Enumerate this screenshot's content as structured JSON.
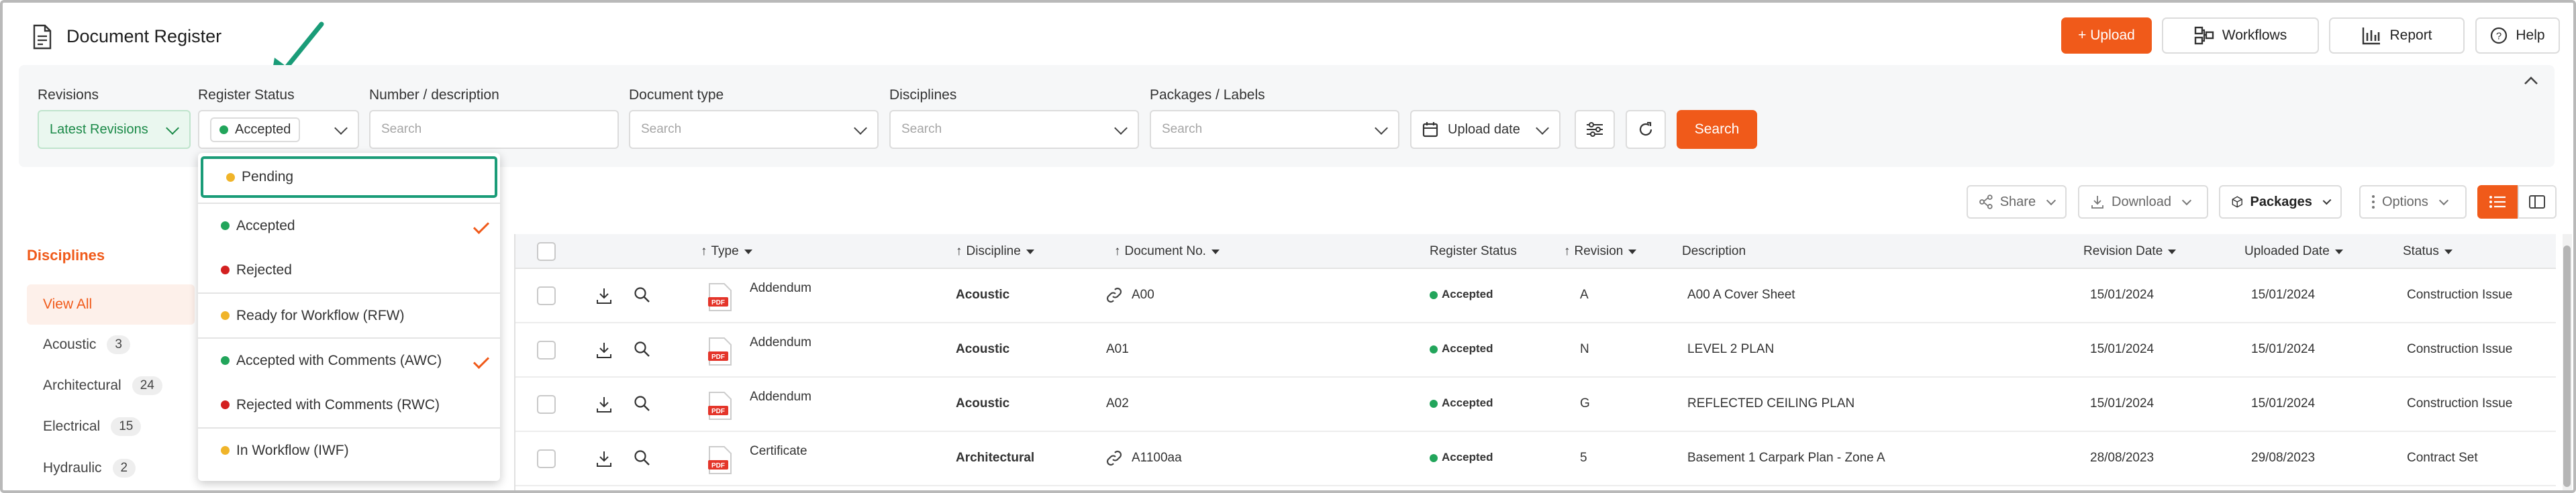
{
  "header": {
    "title": "Document Register",
    "buttons": {
      "upload": "+ Upload",
      "workflows": "Workflows",
      "report": "Report",
      "help": "Help"
    }
  },
  "filters": {
    "revisions": {
      "label": "Revisions",
      "value": "Latest Revisions"
    },
    "register_status": {
      "label": "Register Status",
      "value": "Accepted"
    },
    "number_description": {
      "label": "Number / description",
      "placeholder": "Search"
    },
    "document_type": {
      "label": "Document type",
      "placeholder": "Search"
    },
    "disciplines": {
      "label": "Disciplines",
      "placeholder": "Search"
    },
    "packages_labels": {
      "label": "Packages / Labels",
      "placeholder": "Search"
    },
    "upload_date": "Upload date",
    "search_button": "Search"
  },
  "status_dropdown": {
    "items": [
      {
        "label": "Pending",
        "color": "#f0b429",
        "checked": false,
        "highlighted": true
      },
      {
        "label": "Accepted",
        "color": "#22a55b",
        "checked": true
      },
      {
        "label": "Rejected",
        "color": "#d32020",
        "checked": false
      },
      {
        "label": "Ready for Workflow (RFW)",
        "color": "#f0b429",
        "checked": false
      },
      {
        "label": "Accepted with Comments (AWC)",
        "color": "#22a55b",
        "checked": true
      },
      {
        "label": "Rejected with Comments (RWC)",
        "color": "#d32020",
        "checked": false
      },
      {
        "label": "In Workflow (IWF)",
        "color": "#f0b429",
        "checked": false
      }
    ]
  },
  "toolbar": {
    "share": "Share",
    "download": "Download",
    "packages": "Packages",
    "options": "Options"
  },
  "sidebar": {
    "title": "Disciplines",
    "items": [
      {
        "label": "View All",
        "count": ""
      },
      {
        "label": "Acoustic",
        "count": "3"
      },
      {
        "label": "Architectural",
        "count": "24"
      },
      {
        "label": "Electrical",
        "count": "15"
      },
      {
        "label": "Hydraulic",
        "count": "2"
      }
    ]
  },
  "table": {
    "columns": {
      "type": "Type",
      "discipline": "Discipline",
      "document_no": "Document No.",
      "register_status": "Register Status",
      "revision": "Revision",
      "description": "Description",
      "revision_date": "Revision Date",
      "uploaded_date": "Uploaded Date",
      "status": "Status"
    },
    "rows": [
      {
        "type": "Addendum",
        "discipline": "Acoustic",
        "document_no": "A00",
        "register_status": "Accepted",
        "revision": "A",
        "description": "A00 A Cover Sheet",
        "revision_date": "15/01/2024",
        "uploaded_date": "15/01/2024",
        "status": "Construction Issue"
      },
      {
        "type": "Addendum",
        "discipline": "Acoustic",
        "document_no": "A01",
        "register_status": "Accepted",
        "revision": "N",
        "description": "LEVEL 2 PLAN",
        "revision_date": "15/01/2024",
        "uploaded_date": "15/01/2024",
        "status": "Construction Issue"
      },
      {
        "type": "Addendum",
        "discipline": "Acoustic",
        "document_no": "A02",
        "register_status": "Accepted",
        "revision": "G",
        "description": "REFLECTED CEILING PLAN",
        "revision_date": "15/01/2024",
        "uploaded_date": "15/01/2024",
        "status": "Construction Issue"
      },
      {
        "type": "Certificate",
        "discipline": "Architectural",
        "document_no": "A1100aa",
        "register_status": "Accepted",
        "revision": "5",
        "description": "Basement 1 Carpark Plan - Zone A",
        "revision_date": "28/08/2023",
        "uploaded_date": "29/08/2023",
        "status": "Contract Set"
      }
    ]
  },
  "colors": {
    "accent": "#f05a1a",
    "highlight_border": "#1a9c78",
    "accepted": "#22a55b"
  }
}
